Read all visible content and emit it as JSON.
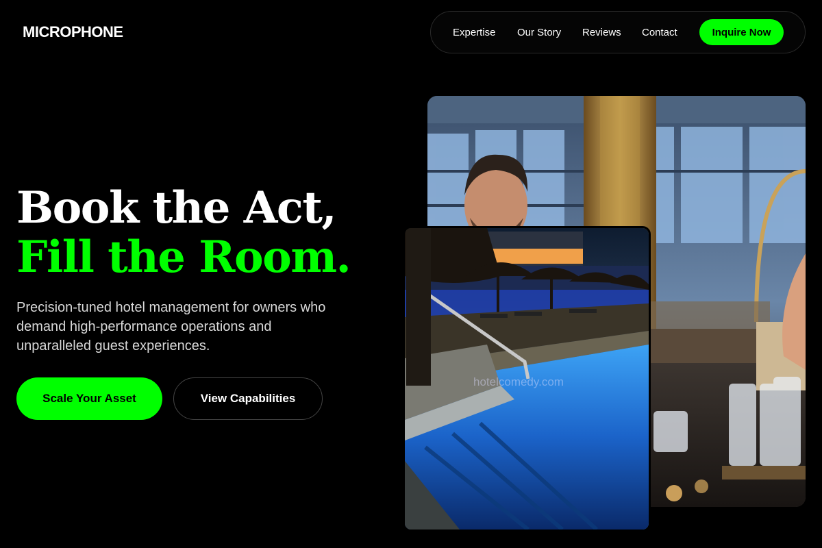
{
  "brand": {
    "name": "MICROPHONE"
  },
  "nav": {
    "links": [
      "Expertise",
      "Our Story",
      "Reviews",
      "Contact"
    ],
    "cta": "Inquire Now"
  },
  "hero": {
    "headline_line1": "Book the Act,",
    "headline_line2": "Fill the Room.",
    "subtitle": "Precision-tuned hotel management for owners who demand high-performance operations and unparalleled guest experiences.",
    "primary_button": "Scale Your Asset",
    "secondary_button": "View Capabilities"
  },
  "images": {
    "back_alt": "Bartender at a hotel bar counter",
    "front_alt": "Hotel pool at dusk with palm umbrellas",
    "watermark": "hotelcomedy.com"
  },
  "colors": {
    "accent": "#00ff00",
    "background": "#000000"
  }
}
